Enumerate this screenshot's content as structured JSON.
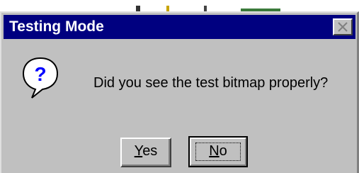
{
  "dialog": {
    "title": "Testing Mode",
    "message": "Did you see the test bitmap properly?",
    "icon": "question-icon",
    "close_icon": "close-icon"
  },
  "buttons": {
    "yes": {
      "mnemonic": "Y",
      "rest": "es"
    },
    "no": {
      "mnemonic": "N",
      "rest": "o"
    }
  },
  "colors": {
    "titlebar": "#000080",
    "dialog_face": "#c0c0c0",
    "title_text": "#ffffff"
  }
}
